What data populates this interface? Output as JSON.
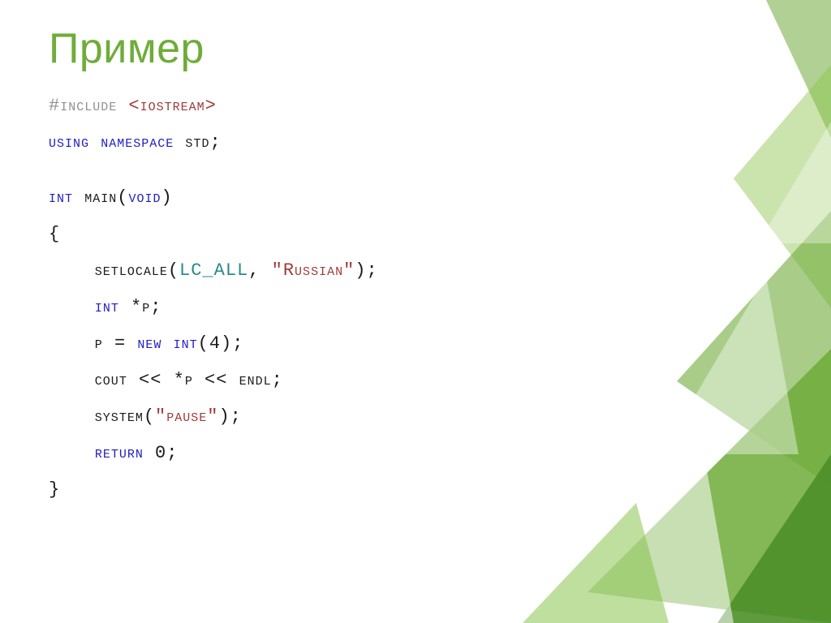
{
  "title": "Пример",
  "code": {
    "l1_hash": "#",
    "l1_include": "include",
    "l1_open": " <",
    "l1_iostream": "iostream",
    "l1_close": ">",
    "l2_using": "using",
    "l2_sp": " ",
    "l2_namespace": "namespace",
    "l2_std": " std",
    "l2_semi": ";",
    "l3_int": "int",
    "l3_main": " main(",
    "l3_void": "void",
    "l3_close": ")",
    "l4_brace": "{",
    "l5_indent": "    setlocale(",
    "l5_lcall": "LC_ALL",
    "l5_comma": ", ",
    "l5_str": "\"Russian\"",
    "l5_close": ");",
    "l6_indent": "    ",
    "l6_int": "int",
    "l6_rest": " *p;",
    "l7_indent": "    p = ",
    "l7_new": "new",
    "l7_sp": " ",
    "l7_int": "int",
    "l7_rest": "(4);",
    "l8_indent": "    cout << *p << endl;",
    "l9_indent": "    system(",
    "l9_str": "\"pause\"",
    "l9_close": ");",
    "l10_indent": "    ",
    "l10_return": "return",
    "l10_rest": " 0;",
    "l11_brace": "}"
  }
}
